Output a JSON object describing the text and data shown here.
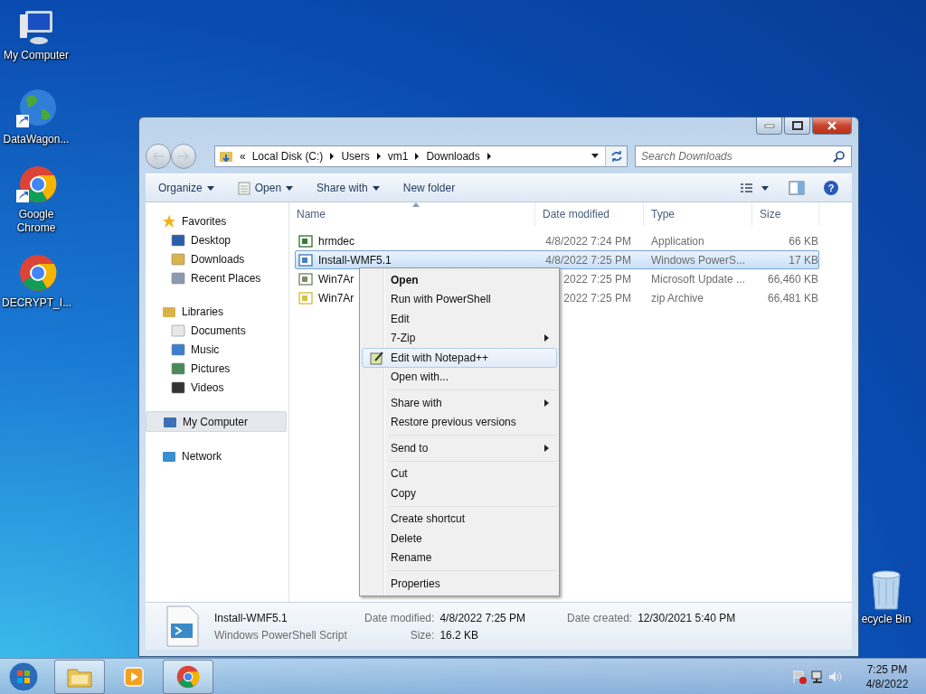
{
  "desktop_icons": [
    {
      "label": "My Computer",
      "kind": "computer",
      "shortcut": false
    },
    {
      "label": "DataWagon...",
      "kind": "globe",
      "shortcut": true
    },
    {
      "label": "Google Chrome",
      "kind": "chrome",
      "shortcut": true
    },
    {
      "label": "DECRYPT_I...",
      "kind": "chrome",
      "shortcut": false
    }
  ],
  "recycle_bin": {
    "label": "ecycle Bin"
  },
  "window": {
    "address": {
      "overflow": "«",
      "crumbs": [
        "Local Disk (C:)",
        "Users",
        "vm1",
        "Downloads"
      ]
    },
    "search": {
      "placeholder": "Search Downloads"
    },
    "toolbar": [
      {
        "label": "Organize",
        "dropdown": true,
        "icon": false
      },
      {
        "label": "Open",
        "dropdown": true,
        "icon": true
      },
      {
        "label": "Share with",
        "dropdown": true,
        "icon": false
      },
      {
        "label": "New folder",
        "dropdown": false,
        "icon": false
      }
    ],
    "sidebar": [
      {
        "label": "Favorites",
        "kind": "star",
        "selected": false,
        "children": [
          {
            "label": "Desktop",
            "kind": "desktop",
            "selected": false
          },
          {
            "label": "Downloads",
            "kind": "downloads",
            "selected": false
          },
          {
            "label": "Recent Places",
            "kind": "recent",
            "selected": false
          }
        ]
      },
      {
        "label": "Libraries",
        "kind": "library",
        "selected": false,
        "children": [
          {
            "label": "Documents",
            "kind": "document",
            "selected": false
          },
          {
            "label": "Music",
            "kind": "music",
            "selected": false
          },
          {
            "label": "Pictures",
            "kind": "picture",
            "selected": false
          },
          {
            "label": "Videos",
            "kind": "video",
            "selected": false
          }
        ]
      },
      {
        "label": "My Computer",
        "kind": "computer",
        "selected": true
      },
      {
        "label": "Network",
        "kind": "network",
        "selected": false
      }
    ],
    "help": {
      "glyph": "?"
    },
    "columns": [
      "Name",
      "Date modified",
      "Type",
      "Size"
    ],
    "files": [
      {
        "name": "hrmdec",
        "date": "4/8/2022 7:24 PM",
        "type": "Application",
        "size": "66 KB",
        "kind": "app",
        "selected": false
      },
      {
        "name": "Install-WMF5.1",
        "date": "4/8/2022 7:25 PM",
        "type": "Windows PowerS...",
        "size": "17 KB",
        "kind": "script",
        "selected": true
      },
      {
        "name": "Win7Ar",
        "date": "2022 7:25 PM",
        "type": "Microsoft Update ...",
        "size": "66,460 KB",
        "kind": "update",
        "selected": false
      },
      {
        "name": "Win7Ar",
        "date": "2022 7:25 PM",
        "type": "zip Archive",
        "size": "66,481 KB",
        "kind": "zip",
        "selected": false
      }
    ],
    "details": {
      "name": "Install-WMF5.1",
      "type": "Windows PowerShell Script",
      "fields": [
        {
          "label": "Date modified:",
          "value": "4/8/2022 7:25 PM"
        },
        {
          "label": "Size:",
          "value": "16.2 KB"
        },
        {
          "label": "Date created:",
          "value": "12/30/2021 5:40 PM"
        }
      ]
    }
  },
  "context_menu": [
    [
      {
        "label": "Open",
        "bold": true,
        "submenu": false,
        "icon": false,
        "selected": false
      },
      {
        "label": "Run with PowerShell",
        "bold": false,
        "submenu": false,
        "icon": false,
        "selected": false
      },
      {
        "label": "Edit",
        "bold": false,
        "submenu": false,
        "icon": false,
        "selected": false
      },
      {
        "label": "7-Zip",
        "bold": false,
        "submenu": true,
        "icon": false,
        "selected": false
      },
      {
        "label": "Edit with Notepad++",
        "bold": false,
        "submenu": false,
        "icon": true,
        "selected": true
      },
      {
        "label": "Open with...",
        "bold": false,
        "submenu": false,
        "icon": false,
        "selected": false
      }
    ],
    [
      {
        "label": "Share with",
        "bold": false,
        "submenu": true,
        "icon": false,
        "selected": false
      },
      {
        "label": "Restore previous versions",
        "bold": false,
        "submenu": false,
        "icon": false,
        "selected": false
      }
    ],
    [
      {
        "label": "Send to",
        "bold": false,
        "submenu": true,
        "icon": false,
        "selected": false
      }
    ],
    [
      {
        "label": "Cut",
        "bold": false,
        "submenu": false,
        "icon": false,
        "selected": false
      },
      {
        "label": "Copy",
        "bold": false,
        "submenu": false,
        "icon": false,
        "selected": false
      }
    ],
    [
      {
        "label": "Create shortcut",
        "bold": false,
        "submenu": false,
        "icon": false,
        "selected": false
      },
      {
        "label": "Delete",
        "bold": false,
        "submenu": false,
        "icon": false,
        "selected": false
      },
      {
        "label": "Rename",
        "bold": false,
        "submenu": false,
        "icon": false,
        "selected": false
      }
    ],
    [
      {
        "label": "Properties",
        "bold": false,
        "submenu": false,
        "icon": false,
        "selected": false
      }
    ]
  ],
  "taskbar": {
    "buttons": [
      {
        "kind": "explorer",
        "running": true
      },
      {
        "kind": "media",
        "running": false
      },
      {
        "kind": "chrome",
        "running": true
      }
    ],
    "time": "7:25 PM",
    "date": "4/8/2022"
  }
}
